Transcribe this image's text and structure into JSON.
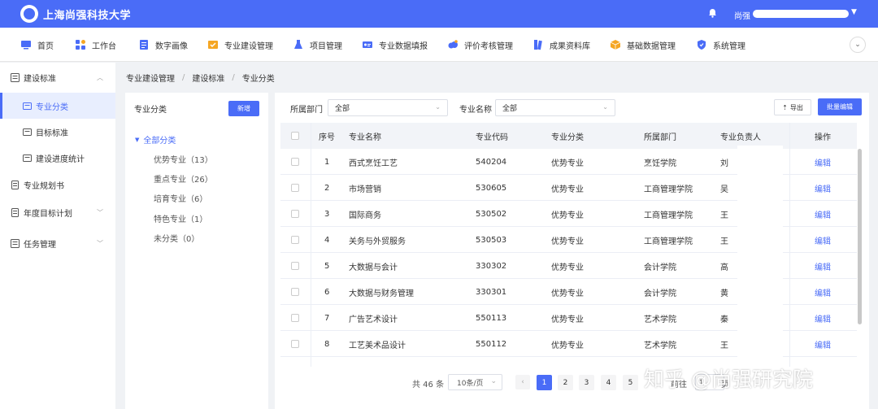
{
  "header": {
    "app_title": "上海尚强科技大学",
    "user_name": "尚强",
    "colors": {
      "primary": "#4a6cf7",
      "header_bg": "#4a6cf7"
    }
  },
  "nav": [
    {
      "label": "首页",
      "icon": "monitor-icon"
    },
    {
      "label": "工作台",
      "icon": "grid-icon"
    },
    {
      "label": "数字画像",
      "icon": "doc-icon"
    },
    {
      "label": "专业建设管理",
      "icon": "badge-icon"
    },
    {
      "label": "项目管理",
      "icon": "flask-icon"
    },
    {
      "label": "专业数据填报",
      "icon": "id-card-icon"
    },
    {
      "label": "评价考核管理",
      "icon": "cloud-icon"
    },
    {
      "label": "成果资料库",
      "icon": "book-icon"
    },
    {
      "label": "基础数据管理",
      "icon": "cube-icon"
    },
    {
      "label": "系统管理",
      "icon": "shield-icon"
    }
  ],
  "sidebar": {
    "items": [
      {
        "label": "建设标准"
      },
      {
        "label": "专业分类"
      },
      {
        "label": "目标标准"
      },
      {
        "label": "建设进度统计"
      },
      {
        "label": "专业规划书"
      },
      {
        "label": "年度目标计划"
      },
      {
        "label": "任务管理"
      }
    ]
  },
  "breadcrumb": [
    "专业建设管理",
    "建设标准",
    "专业分类"
  ],
  "category_panel": {
    "title": "专业分类",
    "add_label": "新增",
    "root": "全部分类",
    "children": [
      "优势专业（13）",
      "重点专业（26）",
      "培育专业（6）",
      "特色专业（1）",
      "未分类（0）"
    ]
  },
  "filters": {
    "dept_label": "所属部门",
    "dept_value": "全部",
    "major_label": "专业名称",
    "major_value": "全部",
    "export_label": "导出",
    "batch_label": "批量编辑"
  },
  "table": {
    "headers": [
      "序号",
      "专业名称",
      "专业代码",
      "专业分类",
      "所属部门",
      "专业负责人",
      "操作"
    ],
    "rows": [
      {
        "no": "1",
        "name": "西式烹饪工艺",
        "code": "540204",
        "category": "优势专业",
        "dept": "烹饪学院",
        "lead": "刘",
        "op": "编辑"
      },
      {
        "no": "2",
        "name": "市场营销",
        "code": "530605",
        "category": "优势专业",
        "dept": "工商管理学院",
        "lead": "吴",
        "op": "编辑"
      },
      {
        "no": "3",
        "name": "国际商务",
        "code": "530502",
        "category": "优势专业",
        "dept": "工商管理学院",
        "lead": "王",
        "op": "编辑"
      },
      {
        "no": "4",
        "name": "关务与外贸服务",
        "code": "530503",
        "category": "优势专业",
        "dept": "工商管理学院",
        "lead": "王",
        "op": "编辑"
      },
      {
        "no": "5",
        "name": "大数据与会计",
        "code": "330302",
        "category": "优势专业",
        "dept": "会计学院",
        "lead": "高",
        "op": "编辑"
      },
      {
        "no": "6",
        "name": "大数据与财务管理",
        "code": "330301",
        "category": "优势专业",
        "dept": "会计学院",
        "lead": "黄",
        "op": "编辑"
      },
      {
        "no": "7",
        "name": "广告艺术设计",
        "code": "550113",
        "category": "优势专业",
        "dept": "艺术学院",
        "lead": "秦",
        "op": "编辑"
      },
      {
        "no": "8",
        "name": "工艺美术品设计",
        "code": "550112",
        "category": "优势专业",
        "dept": "艺术学院",
        "lead": "王",
        "op": "编辑"
      }
    ]
  },
  "pagination": {
    "total": "共 46 条",
    "page_size": "10条/页",
    "pages": [
      "1",
      "2",
      "3",
      "4",
      "5"
    ],
    "current": 1,
    "goto_label": "前往",
    "goto_value": "1",
    "page_unit": "页"
  },
  "watermark": "知乎 @尚强研究院"
}
